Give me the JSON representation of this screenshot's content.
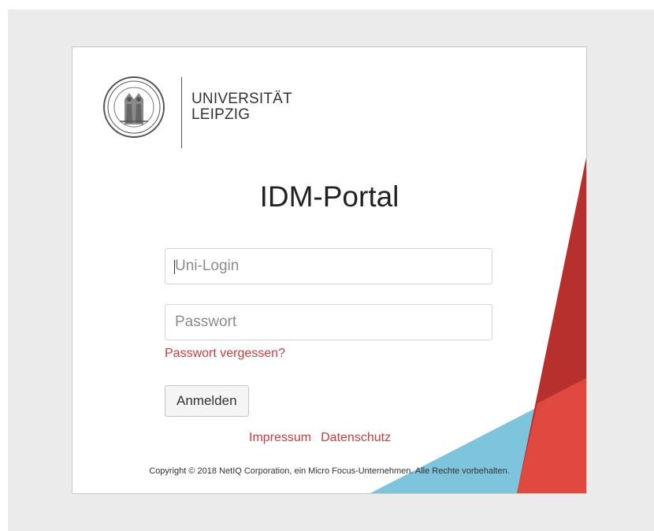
{
  "university": {
    "name_line1": "UNIVERSITÄT",
    "name_line2": "LEIPZIG"
  },
  "portal": {
    "title": "IDM-Portal"
  },
  "form": {
    "login_placeholder": "Uni-Login",
    "password_placeholder": "Passwort",
    "forgot_password": "Passwort vergessen?",
    "submit_label": "Anmelden"
  },
  "footer": {
    "links": [
      "Impressum",
      "Datenschutz"
    ],
    "copyright": "Copyright © 2018 NetIQ Corporation, ein Micro Focus-Unternehmen. Alle Rechte vorbehalten."
  },
  "colors": {
    "link": "#d9383a",
    "dark_red": "#b8302e",
    "light_red": "#e0493f",
    "light_blue": "#7fc4dd",
    "backdrop": "#ebebeb"
  },
  "icons": {
    "logo": "university-seal-icon"
  }
}
